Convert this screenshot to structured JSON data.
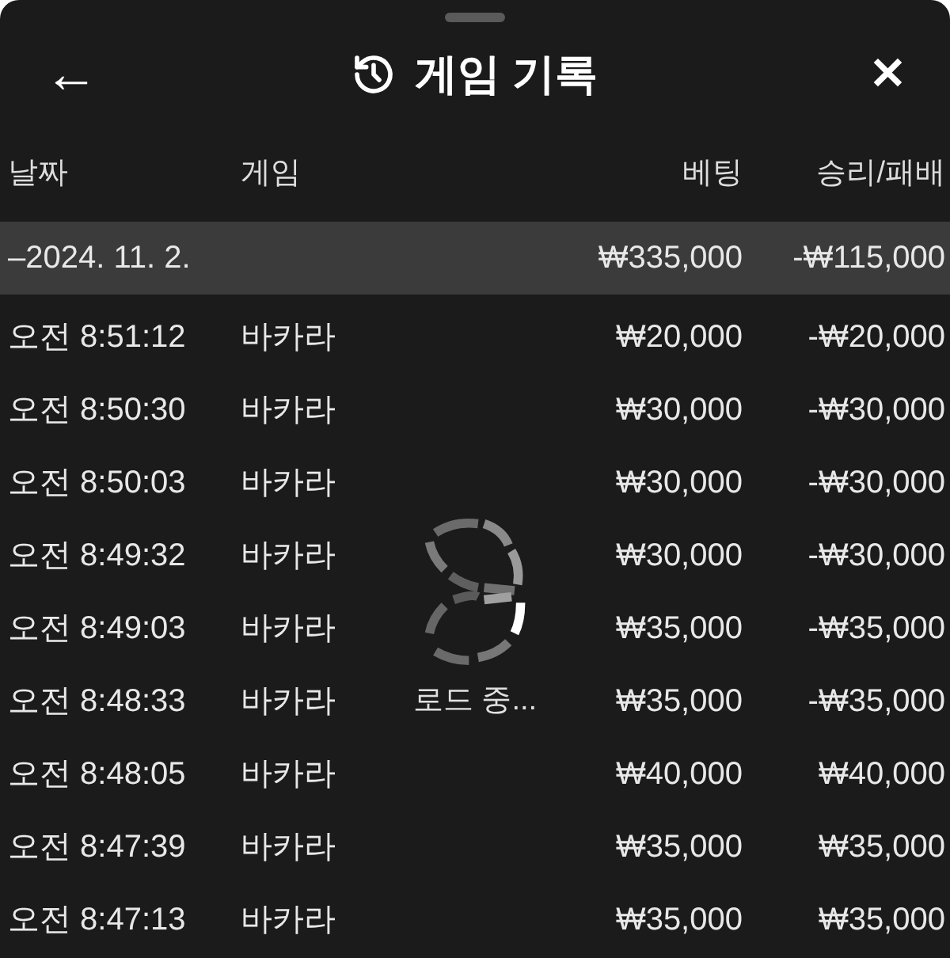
{
  "header": {
    "back": "←",
    "title": "게임 기록",
    "close": "✕"
  },
  "table": {
    "columns": [
      "날짜",
      "게임",
      "베팅",
      "승리/패배"
    ],
    "summary": {
      "date": "–2024. 11. 2.",
      "bet": "₩335,000",
      "result": "-₩115,000"
    },
    "rows": [
      {
        "time": "오전 8:51:12",
        "game": "바카라",
        "bet": "₩20,000",
        "result": "-₩20,000"
      },
      {
        "time": "오전 8:50:30",
        "game": "바카라",
        "bet": "₩30,000",
        "result": "-₩30,000"
      },
      {
        "time": "오전 8:50:03",
        "game": "바카라",
        "bet": "₩30,000",
        "result": "-₩30,000"
      },
      {
        "time": "오전 8:49:32",
        "game": "바카라",
        "bet": "₩30,000",
        "result": "-₩30,000"
      },
      {
        "time": "오전 8:49:03",
        "game": "바카라",
        "bet": "₩35,000",
        "result": "-₩35,000"
      },
      {
        "time": "오전 8:48:33",
        "game": "바카라",
        "bet": "₩35,000",
        "result": "-₩35,000"
      },
      {
        "time": "오전 8:48:05",
        "game": "바카라",
        "bet": "₩40,000",
        "result": "₩40,000"
      },
      {
        "time": "오전 8:47:39",
        "game": "바카라",
        "bet": "₩35,000",
        "result": "₩35,000"
      },
      {
        "time": "오전 8:47:13",
        "game": "바카라",
        "bet": "₩35,000",
        "result": "₩35,000"
      }
    ]
  },
  "loading": {
    "text": "로드 중..."
  }
}
